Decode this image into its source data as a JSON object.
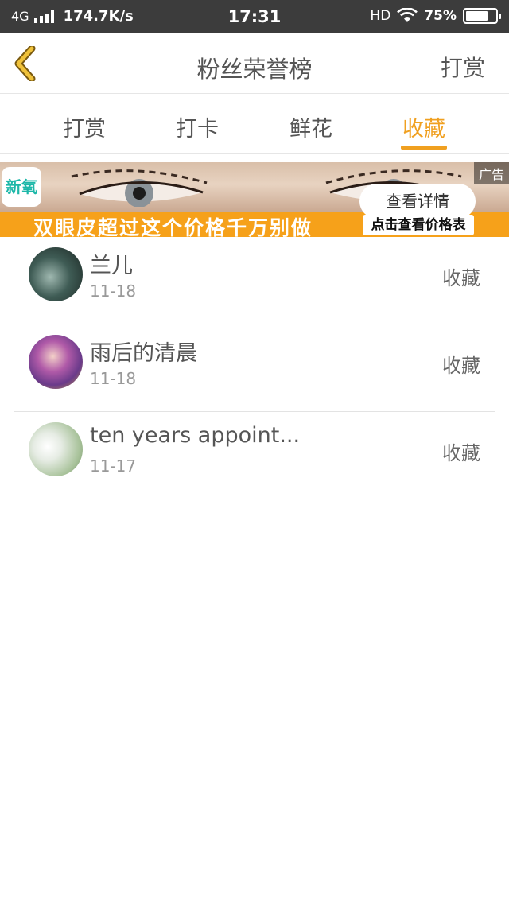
{
  "status_bar": {
    "network": "4G",
    "speed": "174.7K/s",
    "time": "17:31",
    "hd": "HD",
    "battery_percent": "75%",
    "battery_level": 0.75
  },
  "header": {
    "title": "粉丝荣誉榜",
    "action": "打赏",
    "back_icon": "chevron-left-icon",
    "accent_color": "#f0a020"
  },
  "tabs": [
    {
      "label": "打赏",
      "active": false
    },
    {
      "label": "打卡",
      "active": false
    },
    {
      "label": "鲜花",
      "active": false
    },
    {
      "label": "收藏",
      "active": true
    }
  ],
  "ad": {
    "logo_text": "新氧",
    "tag": "广告",
    "caption": "双眼皮超过这个价格千万别做",
    "detail_button": "查看详情",
    "price_button": "点击查看价格表"
  },
  "list": {
    "items": [
      {
        "name": "兰儿",
        "date": "11-18",
        "action": "收藏"
      },
      {
        "name": "雨后的清晨",
        "date": "11-18",
        "action": "收藏"
      },
      {
        "name": "ten years appoint...",
        "date": "11-17",
        "action": "收藏"
      }
    ]
  }
}
